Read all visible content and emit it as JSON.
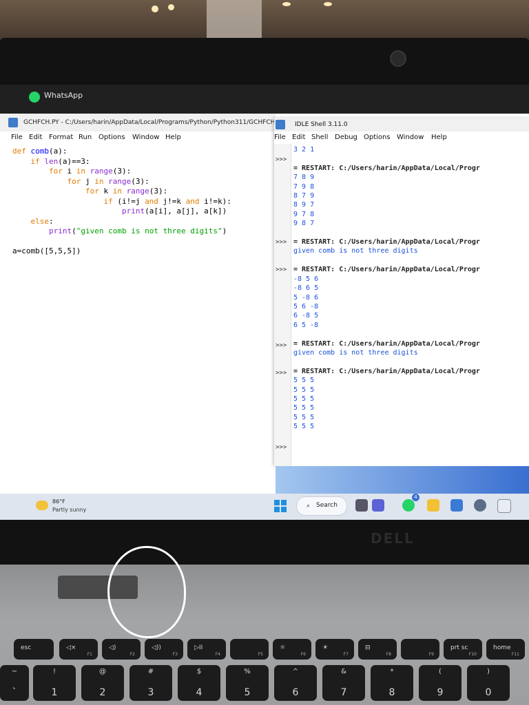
{
  "whatsapp": {
    "title": "WhatsApp"
  },
  "editor": {
    "title": "GCHFCH.PY - C:/Users/harin/AppData/Local/Programs/Python/Python311/GCHFCH.PY (3.11.0)",
    "menu": [
      "File",
      "Edit",
      "Format",
      "Run",
      "Options",
      "Window",
      "Help"
    ]
  },
  "shell": {
    "title": "IDLE Shell 3.11.0",
    "menu": [
      "File",
      "Edit",
      "Shell",
      "Debug",
      "Options",
      "Window",
      "Help"
    ],
    "prompt": ">>>",
    "restart": "= RESTART: C:/Users/harin/AppData/Local/Progr",
    "message": "given comb is not three digits",
    "first_line": "3 2 1",
    "block1": [
      "7 8 9",
      "7 9 8",
      "8 7 9",
      "8 9 7",
      "9 7 8",
      "9 8 7"
    ],
    "block3": [
      "-8 5 6",
      "-8 6 5",
      "5 -8 6",
      "5 6 -8",
      "6 -8 5",
      "6 5 -8"
    ],
    "block5": [
      "5 5 5",
      "5 5 5",
      "5 5 5",
      "5 5 5",
      "5 5 5",
      "5 5 5"
    ]
  },
  "taskbar": {
    "weather_temp": "86°F",
    "weather_desc": "Partly sunny",
    "search_label": "Search",
    "badge": "4"
  },
  "brand": "DELL",
  "keyboard": {
    "frow": [
      {
        "label": "esc",
        "sub": ""
      },
      {
        "label": "◁×",
        "sub": "F1"
      },
      {
        "label": "◁)",
        "sub": "F2"
      },
      {
        "label": "◁))",
        "sub": "F3"
      },
      {
        "label": "▷II",
        "sub": "F4"
      },
      {
        "label": "",
        "sub": "F5"
      },
      {
        "label": "☼",
        "sub": "F6"
      },
      {
        "label": "☀",
        "sub": "F7"
      },
      {
        "label": "⊟",
        "sub": "F8"
      },
      {
        "label": "",
        "sub": "F9"
      },
      {
        "label": "prt sc",
        "sub": "F10"
      },
      {
        "label": "home",
        "sub": "F11"
      }
    ],
    "numrow": [
      {
        "top": "~",
        "bot": "`"
      },
      {
        "top": "!",
        "bot": "1"
      },
      {
        "top": "@",
        "bot": "2"
      },
      {
        "top": "#",
        "bot": "3"
      },
      {
        "top": "$",
        "bot": "4"
      },
      {
        "top": "%",
        "bot": "5"
      },
      {
        "top": "^",
        "bot": "6"
      },
      {
        "top": "&",
        "bot": "7"
      },
      {
        "top": "*",
        "bot": "8"
      },
      {
        "top": "(",
        "bot": "9"
      },
      {
        "top": ")",
        "bot": "0"
      }
    ]
  }
}
